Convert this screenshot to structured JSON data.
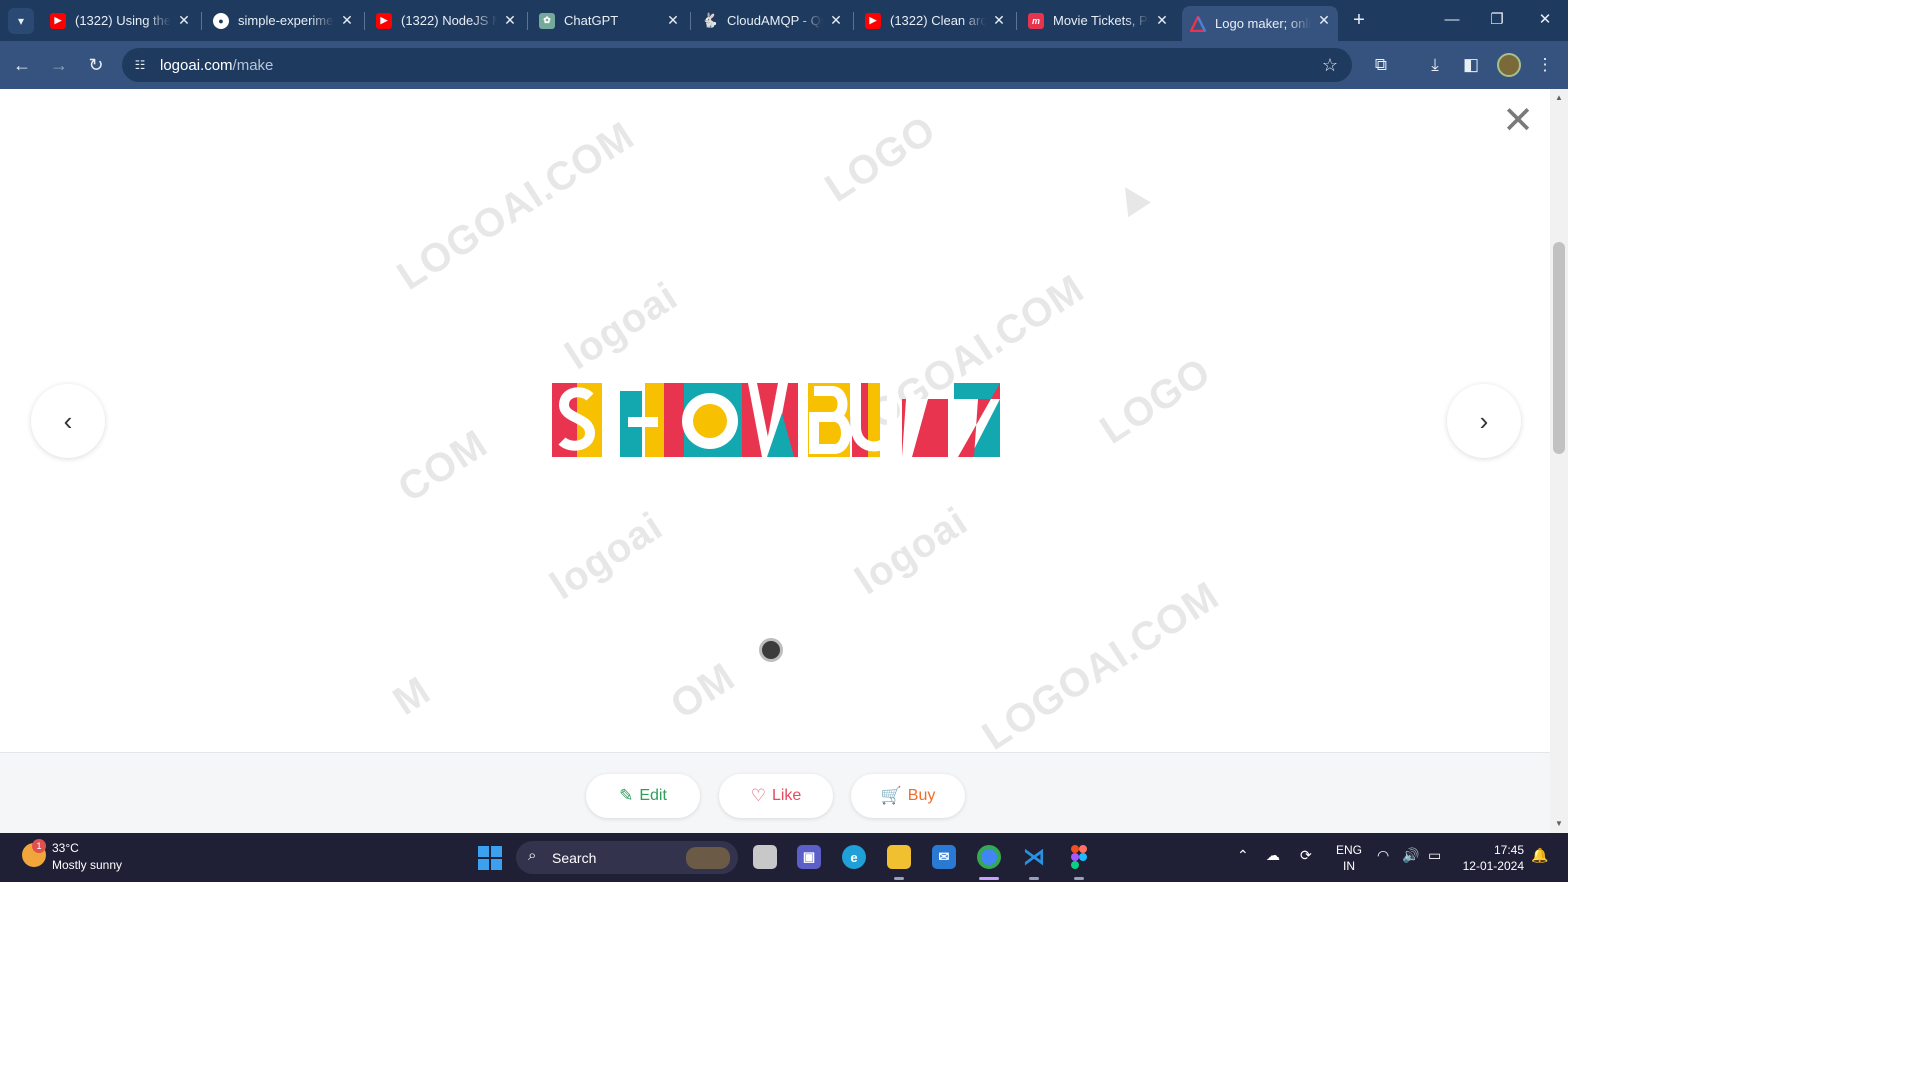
{
  "browser": {
    "tabs": [
      {
        "title": "(1322) Using the",
        "favicon": "youtube-icon",
        "color": "#ff0000"
      },
      {
        "title": "simple-experime",
        "favicon": "github-icon",
        "color": "#ffffff"
      },
      {
        "title": "(1322) NodeJS M",
        "favicon": "youtube-icon",
        "color": "#ff0000"
      },
      {
        "title": "ChatGPT",
        "favicon": "chatgpt-icon",
        "color": "#74aa9c"
      },
      {
        "title": "CloudAMQP - Qu",
        "favicon": "cloudamqp-icon",
        "color": "#ffffff"
      },
      {
        "title": "(1322) Clean arc",
        "favicon": "youtube-icon",
        "color": "#ff0000"
      },
      {
        "title": "Movie Tickets, Pl",
        "favicon": "bookmyshow-icon",
        "color": "#e4344e"
      },
      {
        "title": "Logo maker; onli",
        "favicon": "logoai-icon",
        "color": "#4a7fd4",
        "active": true
      }
    ],
    "url_domain": "logoai.com",
    "url_path": "/make"
  },
  "logo": {
    "letters": [
      "S",
      "H",
      "O",
      "W",
      "B",
      "U",
      "Z",
      "Z"
    ],
    "colors": {
      "red": "#e8344e",
      "yellow": "#f7c000",
      "teal": "#13a8b0"
    }
  },
  "watermarks": [
    "LOGOAI.COM",
    "LOGO",
    "logoai",
    "LOGOAI.COM",
    "LOGO",
    "COM",
    "logoai",
    "logoai",
    "LOGOAI.COM",
    "M",
    "OM",
    "LOGOAI.COM"
  ],
  "actions": {
    "edit_label": "Edit",
    "like_label": "Like",
    "buy_label": "Buy",
    "edit_color": "#2e9e5b",
    "like_color": "#e84a5f",
    "buy_color": "#f26b2a"
  },
  "taskbar": {
    "weather_temp": "33°C",
    "weather_desc": "Mostly sunny",
    "weather_badge": "1",
    "search_label": "Search",
    "lang_top": "ENG",
    "lang_bottom": "IN",
    "time": "17:45",
    "date": "12-01-2024"
  }
}
